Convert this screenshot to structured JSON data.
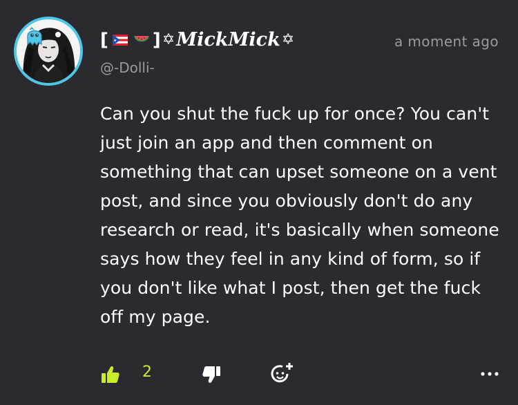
{
  "comment": {
    "author": {
      "name_open": "[",
      "name_close": "]",
      "name": "MickMick",
      "star_left": "✡",
      "star_right": "✡",
      "flag_icon": "puerto-rico-flag-icon",
      "melon_icon": "watermelon-icon",
      "handle": "@-Dolli-",
      "ring_color": "#4fc6e6"
    },
    "timestamp": "a moment ago",
    "body": "Can you shut the fuck up for once? You can't just join an app and then comment on something that can upset someone on a vent post, and since you obviously don't do any research or read, it's basically when someone says how they feel in any kind of form, so if you don't like what I post, then get the fuck off my page.",
    "actions": {
      "like_icon": "thumbs-up-icon",
      "like_count": "2",
      "dislike_icon": "thumbs-down-icon",
      "react_icon": "add-reaction-icon",
      "more_icon": "more-options-icon",
      "accent_color": "#c6ef2a"
    }
  }
}
